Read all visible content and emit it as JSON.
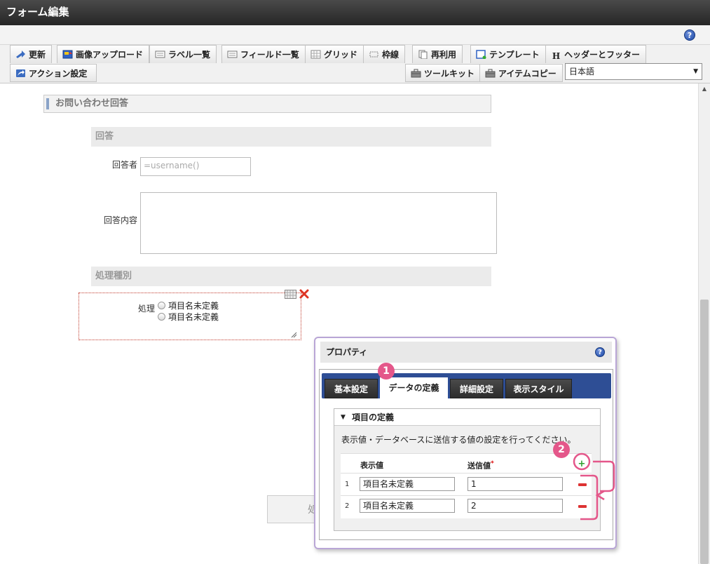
{
  "title": "フォーム編集",
  "toolbar": {
    "row1": [
      "更新",
      "画像アップロード",
      "ラベル一覧",
      "フィールド一覧",
      "グリッド",
      "枠線",
      "再利用",
      "テンプレート",
      "ヘッダーとフッター"
    ],
    "row2_left": "アクション設定",
    "row2_right": [
      "ツールキット",
      "アイテムコピー"
    ],
    "language": "日本語"
  },
  "form": {
    "section_title": "お問い合わせ回答",
    "answer_heading": "回答",
    "respondent_label": "回答者",
    "respondent_value": "=username()",
    "content_label": "回答内容",
    "processing_heading": "処理種別",
    "processing_label": "処理",
    "radio_options": [
      "項目名未定義",
      "項目名未定義"
    ],
    "button_partial": "処"
  },
  "properties": {
    "title": "プロパティ",
    "tabs": [
      "基本設定",
      "データの定義",
      "詳細設定",
      "表示スタイル"
    ],
    "active_tab": "データの定義",
    "section_title": "項目の定義",
    "description": "表示値・データベースに送信する値の設定を行ってください。",
    "col_display": "表示値",
    "col_send": "送信値",
    "required_mark": "*",
    "rows": [
      {
        "num": "1",
        "display": "項目名未定義",
        "send": "1"
      },
      {
        "num": "2",
        "display": "項目名未定義",
        "send": "2"
      }
    ]
  },
  "annotations": {
    "badge1": "1",
    "badge2": "2",
    "accent_color": "#e4578a"
  }
}
